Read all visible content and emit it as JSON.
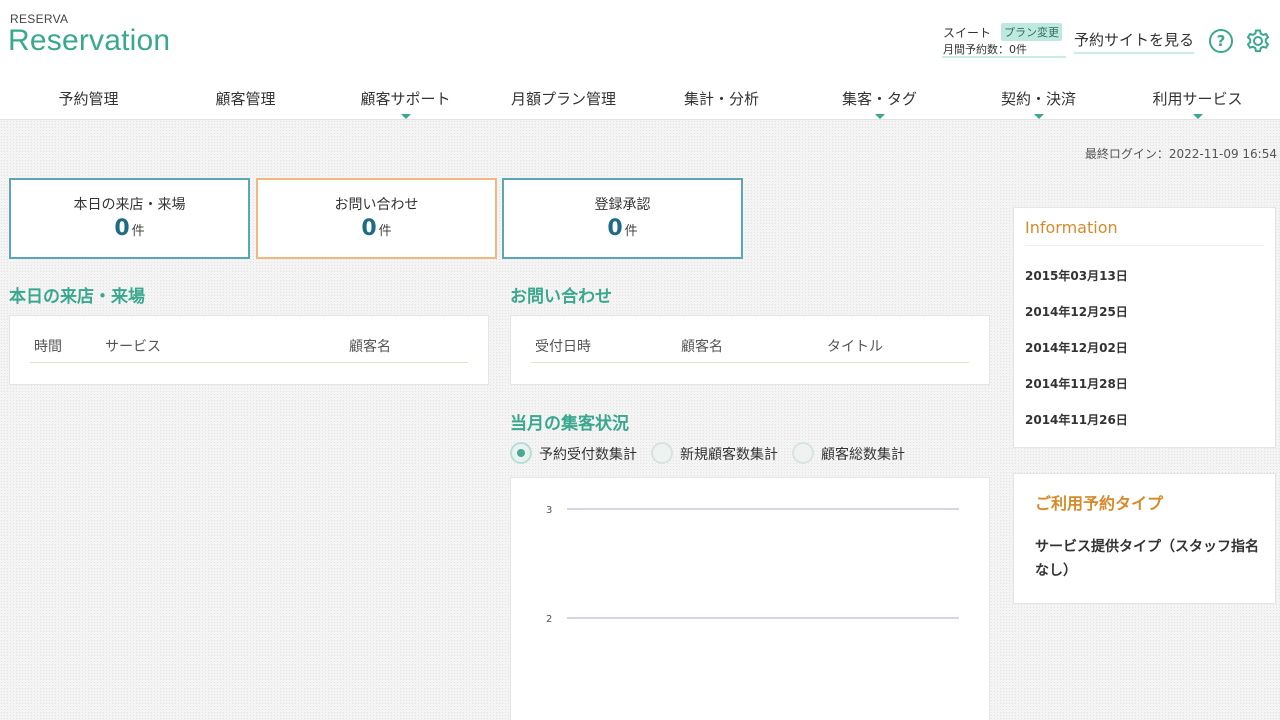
{
  "brand": {
    "small": "RESERVA",
    "large": "Reservation"
  },
  "plan": {
    "name": "スイート",
    "change_label": "プラン変更",
    "monthly_count": "月間予約数：0件"
  },
  "header": {
    "site_link": "予約サイトを見る",
    "help_icon": "question-circle-icon",
    "settings_icon": "gear-icon",
    "accent": "#3aa88e"
  },
  "nav": [
    {
      "label": "予約管理",
      "dropdown": false
    },
    {
      "label": "顧客管理",
      "dropdown": false
    },
    {
      "label": "顧客サポート",
      "dropdown": true
    },
    {
      "label": "月額プラン管理",
      "dropdown": false
    },
    {
      "label": "集計・分析",
      "dropdown": false
    },
    {
      "label": "集客・タグ",
      "dropdown": true
    },
    {
      "label": "契約・決済",
      "dropdown": true
    },
    {
      "label": "利用サービス",
      "dropdown": true
    }
  ],
  "last_login": "最終ログイン：2022-11-09 16:54",
  "stats": [
    {
      "label": "本日の来店・来場",
      "value": "0",
      "unit": "件"
    },
    {
      "label": "お問い合わせ",
      "value": "0",
      "unit": "件"
    },
    {
      "label": "登録承認",
      "value": "0",
      "unit": "件"
    }
  ],
  "visits": {
    "title": "本日の来店・来場",
    "headers": [
      "時間",
      "サービス",
      "顧客名"
    ]
  },
  "inquiries": {
    "title": "お問い合わせ",
    "headers": [
      "受付日時",
      "顧客名",
      "タイトル"
    ]
  },
  "stats_section": {
    "title": "当月の集客状況",
    "options": [
      "予約受付数集計",
      "新規顧客数集計",
      "顧客総数集計"
    ],
    "selected": "予約受付数集計"
  },
  "chart_data": {
    "type": "line",
    "y_ticks": [
      "3",
      "2"
    ],
    "series": []
  },
  "information": {
    "title": "Information",
    "items": [
      "2015年03月13日",
      "2014年12月25日",
      "2014年12月02日",
      "2014年11月28日",
      "2014年11月26日"
    ]
  },
  "reservation_type": {
    "title": "ご利用予約タイプ",
    "body": "サービス提供タイプ（スタッフ指名なし）"
  }
}
